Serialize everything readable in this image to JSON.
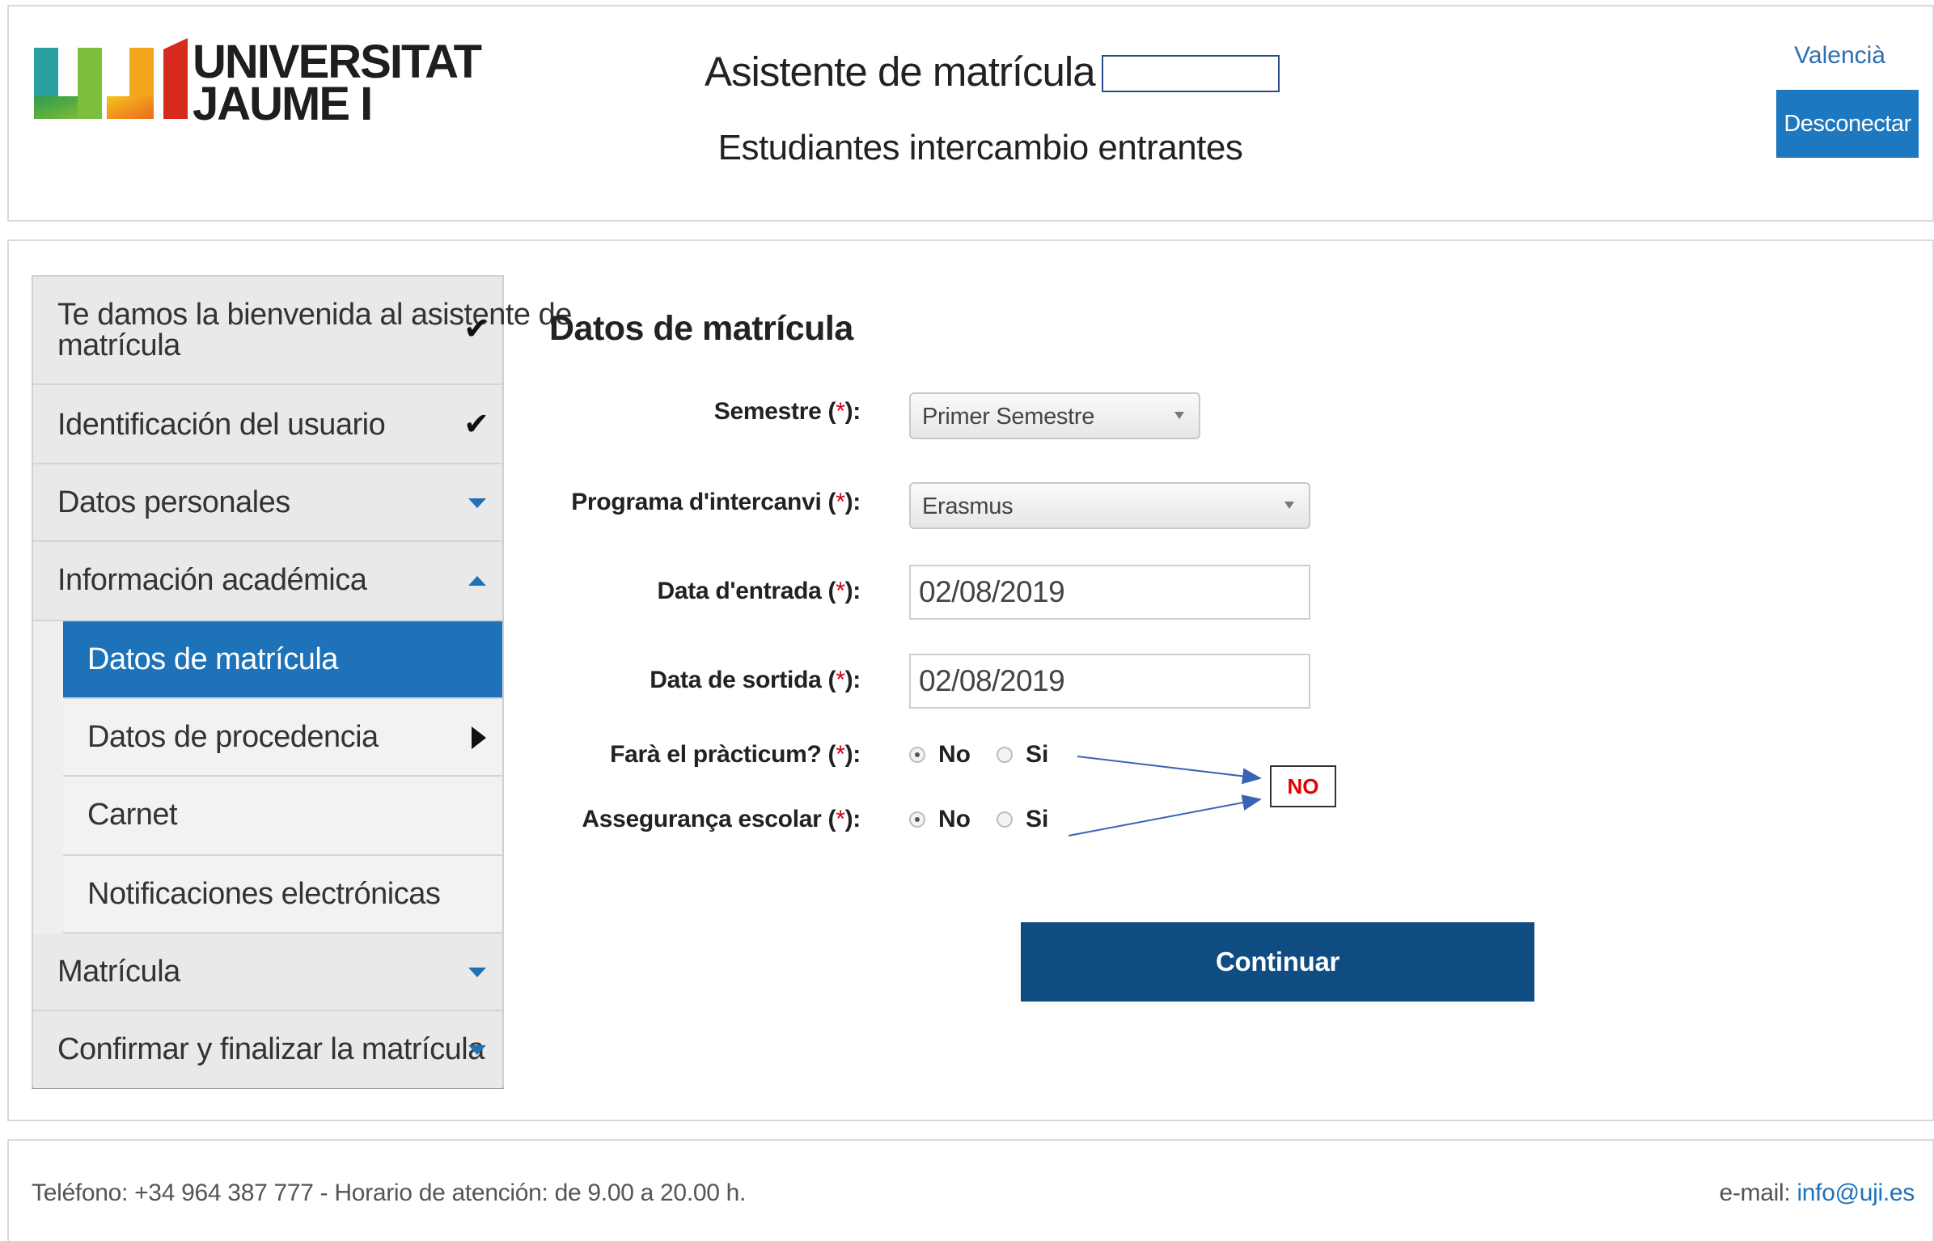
{
  "header": {
    "logo_text_line1": "UNIVERSITAT",
    "logo_text_line2": "JAUME I",
    "app_title": "Asistente de matrícula",
    "subtitle": "Estudiantes intercambio entrantes",
    "language_link": "Valencià",
    "disconnect_label": "Desconectar"
  },
  "sidebar": {
    "items": [
      {
        "label_line1": "Te damos la bienvenida al asistente de",
        "label_line2": "matrícula",
        "icon": "check-icon"
      },
      {
        "label": "Identificación del usuario",
        "icon": "check-icon"
      },
      {
        "label": "Datos personales",
        "icon": "expand-arrow-icon"
      },
      {
        "label": "Información académica",
        "icon": "collapse-arrow-icon"
      },
      {
        "label": "Datos de matrícula",
        "icon": ""
      },
      {
        "label": "Datos de procedencia",
        "icon": "submenu-arrow-icon"
      },
      {
        "label": "Carnet",
        "icon": ""
      },
      {
        "label": "Notificaciones electrónicas",
        "icon": ""
      },
      {
        "label": "Matrícula",
        "icon": "expand-arrow-icon"
      },
      {
        "label": "Confirmar y finalizar la matrícula",
        "icon": "expand-arrow-icon"
      }
    ]
  },
  "form": {
    "title": "Datos de matrícula",
    "required_mark": "*",
    "semestre": {
      "label": "Semestre",
      "value": "Primer Semestre"
    },
    "programa": {
      "label": "Programa d'intercanvi",
      "value": "Erasmus"
    },
    "data_entrada": {
      "label": "Data d'entrada",
      "value": "02/08/2019"
    },
    "data_sortida": {
      "label": "Data de sortida",
      "value": "02/08/2019"
    },
    "practicum": {
      "label": "Farà el pràcticum?",
      "options": [
        "No",
        "Si"
      ],
      "selected": "No"
    },
    "asseguranca": {
      "label": "Assegurança escolar",
      "options": [
        "No",
        "Si"
      ],
      "selected": "No"
    },
    "continue_label": "Continuar"
  },
  "annotation": {
    "text": "NO",
    "color": "#e00000"
  },
  "footer": {
    "phone_text": "Teléfono: +34 964 387 777 - Horario de atención: de 9.00 a 20.00 h.",
    "email_prefix": "e-mail:",
    "email": "info@uji.es"
  },
  "colors": {
    "primary_blue": "#1d72b8",
    "button_dark": "#0f4c81",
    "required_red": "#d0021b"
  }
}
